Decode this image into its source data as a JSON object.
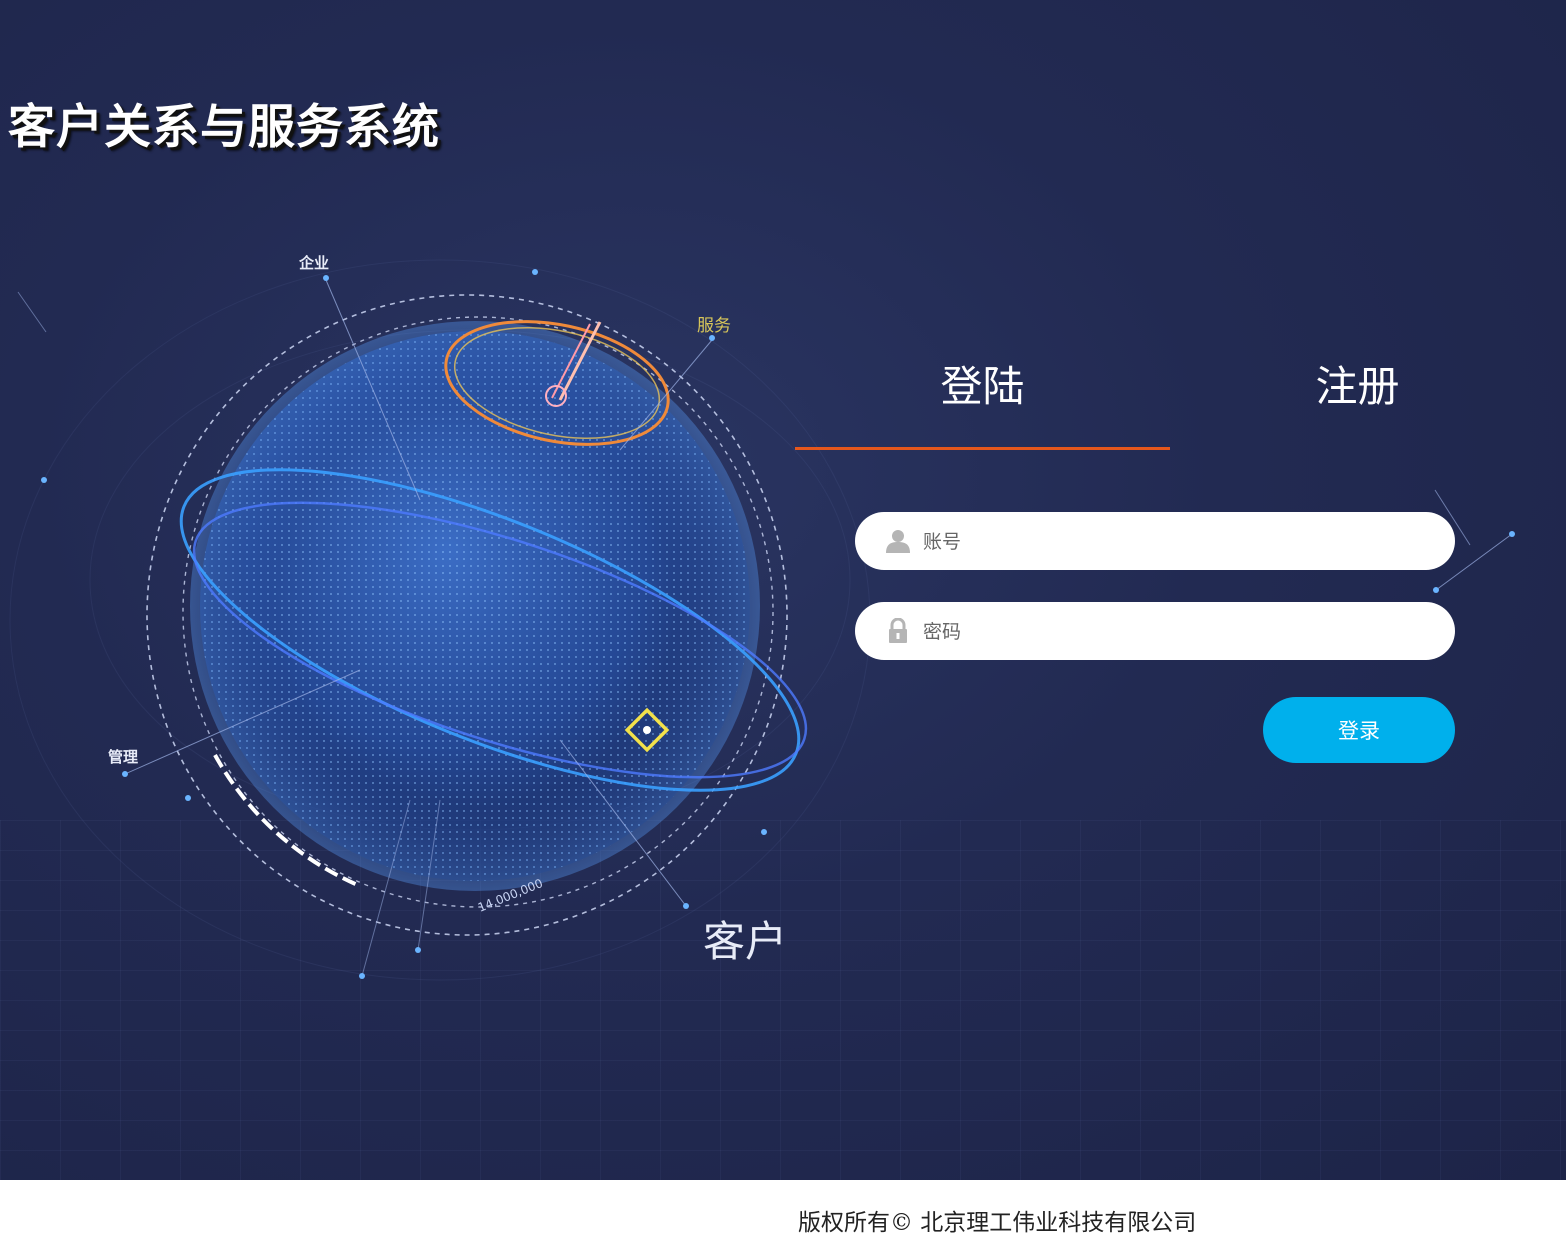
{
  "app": {
    "title": "客户关系与服务系统"
  },
  "illustration": {
    "label_enterprise": "企业",
    "label_service": "服务",
    "label_manage": "管理",
    "label_customer": "客户",
    "ring_number": "14,000,000"
  },
  "tabs": {
    "login_label": "登陆",
    "register_label": "注册",
    "active": "login"
  },
  "form": {
    "account_placeholder": "账号",
    "account_value": "",
    "password_placeholder": "密码",
    "password_value": "",
    "submit_label": "登录"
  },
  "footer": {
    "copyright": "版权所有© 北京理工伟业科技有限公司"
  },
  "colors": {
    "background": "#222a52",
    "accent_tab": "#e5571c",
    "button": "#00b0ec",
    "service_label": "#d8c65a"
  },
  "icons": {
    "account": "user-icon",
    "password": "lock-icon"
  }
}
